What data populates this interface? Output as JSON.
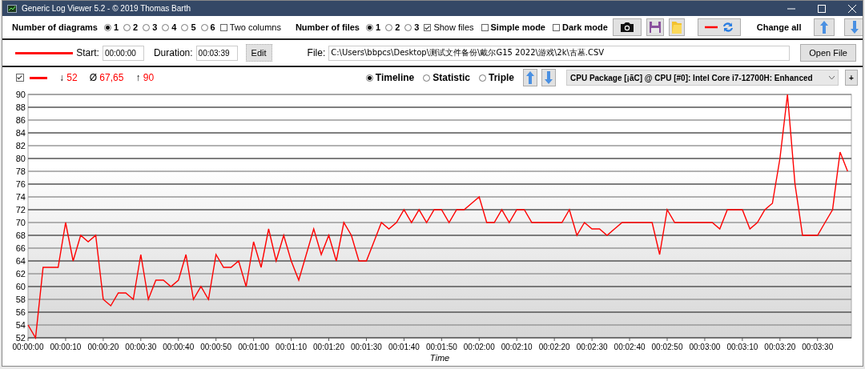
{
  "window": {
    "title": "Generic Log Viewer 5.2 - © 2019 Thomas Barth"
  },
  "toolbar": {
    "diagrams": {
      "label": "Number of diagrams",
      "options": [
        {
          "label": "1",
          "selected": true
        },
        {
          "label": "2",
          "selected": false
        },
        {
          "label": "3",
          "selected": false
        },
        {
          "label": "4",
          "selected": false
        },
        {
          "label": "5",
          "selected": false
        },
        {
          "label": "6",
          "selected": false
        }
      ]
    },
    "two_columns": {
      "label": "Two columns",
      "checked": false
    },
    "files": {
      "label": "Number of files",
      "options": [
        {
          "label": "1",
          "selected": true
        },
        {
          "label": "2",
          "selected": false
        },
        {
          "label": "3",
          "selected": false
        }
      ]
    },
    "show_files": {
      "label": "Show files",
      "checked": true
    },
    "simple_mode": {
      "label": "Simple mode",
      "checked": false
    },
    "dark_mode": {
      "label": "Dark mode",
      "checked": false
    },
    "change_all": "Change all"
  },
  "file_row": {
    "start": {
      "label": "Start:",
      "value": "00:00:00"
    },
    "duration": {
      "label": "Duration:",
      "value": "00:03:39"
    },
    "edit_button": "Edit",
    "file": {
      "label": "File:",
      "value": "C:\\Users\\bbpcs\\Desktop\\测试文件备份\\戴尔G15 2022\\游戏\\2k\\古墓.CSV"
    },
    "open_button": "Open File"
  },
  "series_row": {
    "checked": true,
    "stats": [
      {
        "symbol": "↓",
        "value": "52"
      },
      {
        "symbol": "Ø",
        "value": "67,65"
      },
      {
        "symbol": "↑",
        "value": "90"
      }
    ],
    "modes": [
      {
        "label": "Timeline",
        "selected": true
      },
      {
        "label": "Statistic",
        "selected": false
      },
      {
        "label": "Triple",
        "selected": false
      }
    ],
    "sensor": "CPU Package [¡ãC] @ CPU [#0]: Intel Core i7-12700H: Enhanced",
    "add_button": "+"
  },
  "chart": {
    "chart_data": {
      "type": "line",
      "xlabel": "Time",
      "grid": true,
      "x": [
        0,
        2,
        4,
        6,
        8,
        10,
        12,
        14,
        16,
        18,
        20,
        22,
        24,
        26,
        28,
        30,
        32,
        34,
        36,
        38,
        40,
        42,
        44,
        46,
        48,
        50,
        52,
        54,
        56,
        58,
        60,
        62,
        64,
        66,
        68,
        70,
        72,
        74,
        76,
        78,
        80,
        82,
        84,
        86,
        88,
        90,
        92,
        94,
        96,
        98,
        100,
        102,
        104,
        106,
        108,
        110,
        112,
        114,
        116,
        118,
        120,
        122,
        124,
        126,
        128,
        130,
        132,
        134,
        136,
        138,
        140,
        142,
        144,
        146,
        148,
        150,
        152,
        154,
        156,
        158,
        160,
        162,
        164,
        166,
        168,
        170,
        172,
        174,
        176,
        178,
        180,
        182,
        184,
        186,
        188,
        190,
        192,
        194,
        196,
        198,
        200,
        202,
        204,
        206,
        208,
        210,
        212,
        214,
        216,
        218
      ],
      "values": [
        54,
        52,
        63,
        63,
        63,
        70,
        64,
        68,
        67,
        68,
        58,
        57,
        59,
        59,
        58,
        65,
        58,
        61,
        61,
        60,
        61,
        65,
        58,
        60,
        58,
        65,
        63,
        63,
        64,
        60,
        67,
        63,
        69,
        64,
        68,
        64,
        61,
        65,
        69,
        65,
        68,
        64,
        70,
        68,
        64,
        64,
        67,
        70,
        69,
        70,
        72,
        70,
        72,
        70,
        72,
        72,
        70,
        72,
        72,
        73,
        74,
        70,
        70,
        72,
        70,
        72,
        72,
        70,
        70,
        70,
        70,
        70,
        72,
        68,
        70,
        69,
        69,
        68,
        69,
        70,
        70,
        70,
        70,
        70,
        65,
        72,
        70,
        70,
        70,
        70,
        70,
        70,
        69,
        72,
        72,
        72,
        69,
        70,
        72,
        73,
        80,
        90,
        76,
        68,
        68,
        68,
        70,
        72,
        81,
        78
      ],
      "xlim": [
        0,
        219
      ],
      "ylim": [
        52,
        90
      ],
      "yticks": [
        52,
        54,
        56,
        58,
        60,
        62,
        64,
        66,
        68,
        70,
        72,
        74,
        76,
        78,
        80,
        82,
        84,
        86,
        88,
        90
      ],
      "xticks": [
        {
          "value": 0,
          "label": "00:00:00"
        },
        {
          "value": 10,
          "label": "00:00:10"
        },
        {
          "value": 20,
          "label": "00:00:20"
        },
        {
          "value": 30,
          "label": "00:00:30"
        },
        {
          "value": 40,
          "label": "00:00:40"
        },
        {
          "value": 50,
          "label": "00:00:50"
        },
        {
          "value": 60,
          "label": "00:01:00"
        },
        {
          "value": 70,
          "label": "00:01:10"
        },
        {
          "value": 80,
          "label": "00:01:20"
        },
        {
          "value": 90,
          "label": "00:01:30"
        },
        {
          "value": 100,
          "label": "00:01:40"
        },
        {
          "value": 110,
          "label": "00:01:50"
        },
        {
          "value": 120,
          "label": "00:02:00"
        },
        {
          "value": 130,
          "label": "00:02:10"
        },
        {
          "value": 140,
          "label": "00:02:20"
        },
        {
          "value": 150,
          "label": "00:02:30"
        },
        {
          "value": 160,
          "label": "00:02:40"
        },
        {
          "value": 170,
          "label": "00:02:50"
        },
        {
          "value": 180,
          "label": "00:03:00"
        },
        {
          "value": 190,
          "label": "00:03:10"
        },
        {
          "value": 200,
          "label": "00:03:20"
        },
        {
          "value": 210,
          "label": "00:03:30"
        }
      ]
    }
  }
}
